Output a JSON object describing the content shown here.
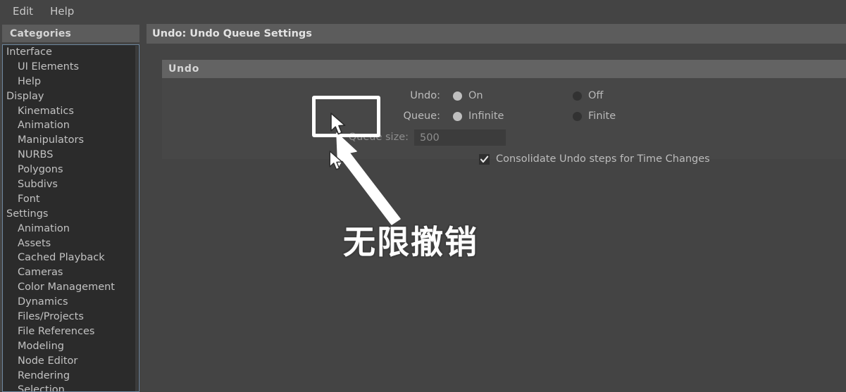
{
  "menubar": {
    "items": [
      {
        "label": "Edit"
      },
      {
        "label": "Help"
      }
    ]
  },
  "sidebar": {
    "header": "Categories",
    "items": [
      {
        "label": "Interface",
        "level": "group"
      },
      {
        "label": "UI Elements",
        "level": "child"
      },
      {
        "label": "Help",
        "level": "child"
      },
      {
        "label": "Display",
        "level": "group"
      },
      {
        "label": "Kinematics",
        "level": "child"
      },
      {
        "label": "Animation",
        "level": "child"
      },
      {
        "label": "Manipulators",
        "level": "child"
      },
      {
        "label": "NURBS",
        "level": "child"
      },
      {
        "label": "Polygons",
        "level": "child"
      },
      {
        "label": "Subdivs",
        "level": "child"
      },
      {
        "label": "Font",
        "level": "child"
      },
      {
        "label": "Settings",
        "level": "group"
      },
      {
        "label": "Animation",
        "level": "child"
      },
      {
        "label": "Assets",
        "level": "child"
      },
      {
        "label": "Cached Playback",
        "level": "child"
      },
      {
        "label": "Cameras",
        "level": "child"
      },
      {
        "label": "Color Management",
        "level": "child"
      },
      {
        "label": "Dynamics",
        "level": "child"
      },
      {
        "label": "Files/Projects",
        "level": "child"
      },
      {
        "label": "File References",
        "level": "child"
      },
      {
        "label": "Modeling",
        "level": "child"
      },
      {
        "label": "Node Editor",
        "level": "child"
      },
      {
        "label": "Rendering",
        "level": "child"
      },
      {
        "label": "Selection",
        "level": "child"
      }
    ]
  },
  "main": {
    "title": "Undo: Undo Queue Settings",
    "frame": {
      "header": "Undo",
      "undo_row": {
        "label": "Undo:",
        "option_on": "On",
        "option_off": "Off",
        "selected": "On"
      },
      "queue_row": {
        "label": "Queue:",
        "option_infinite": "Infinite",
        "option_finite": "Finite",
        "selected": "Infinite"
      },
      "queue_size_row": {
        "label": "Queue size:",
        "value": "500"
      },
      "consolidate_row": {
        "label": "Consolidate Undo steps for Time Changes",
        "checked": true
      }
    }
  },
  "annotation": {
    "note_text": "无限撤销",
    "highlight_target": "Infinite",
    "colors": {
      "annotation": "#ffffff",
      "panel_bg": "#444444",
      "frame_bg": "#474747",
      "header_bg": "#5c5c5c",
      "list_bg": "#2b2b2b",
      "list_focus_border": "#6f88a0",
      "text": "#c2c2c2",
      "radio_selected": "#bfbfbf",
      "radio_unselected": "#323232"
    }
  }
}
